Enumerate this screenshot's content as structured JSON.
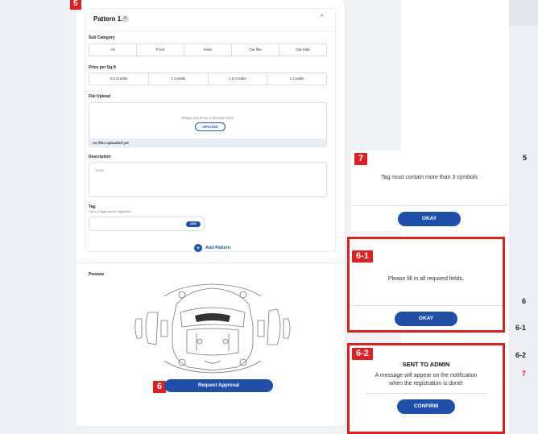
{
  "markers": {
    "m5": "5",
    "m6": "6",
    "m7": "7",
    "m61": "6-1",
    "m62": "6-2"
  },
  "pattern": {
    "title": "Pattern 1.",
    "close_symbol": "×",
    "chevron": "^"
  },
  "sub_category": {
    "label": "Sub Category",
    "options": [
      "All",
      "Front",
      "Inner",
      "Out flex",
      "Out Side"
    ]
  },
  "price": {
    "label": "Price per Sq.ft",
    "options": [
      "0.5 Credits",
      "1 Credits",
      "1.5 Credits",
      "2 Credits"
    ]
  },
  "file_upload": {
    "label": "File Upload",
    "hint": "Drage and Drop or Browse Files",
    "button": "UPLOAD",
    "status": "no files uploaded yet"
  },
  "description": {
    "label": "Description",
    "placeholder": "Enter.."
  },
  "tag": {
    "label": "Tag",
    "note": "*Up to 5 tags can be registered.",
    "add_button": "ADD"
  },
  "add_pattern": {
    "label": "Add Pattern",
    "icon": "plus-circle-icon"
  },
  "preview": {
    "label": "Preview",
    "image": "car-wrap-template"
  },
  "request_button": "Request Approval",
  "dialog7": {
    "message": "Tag must contain more than 3 symbols",
    "button": "OKAY"
  },
  "dialog61": {
    "message": "Please fill in all required fields.",
    "button": "OKAY"
  },
  "dialog62": {
    "title": "SENT TO ADMIN",
    "line1": "A message will appear on the notification",
    "line2": "when the registration is done!",
    "button": "CONFIRM"
  },
  "side_markers": [
    "5",
    "6",
    "6-1",
    "6-2",
    "7"
  ],
  "colors": {
    "primary": "#1f4fa8",
    "marker_red": "#e02020"
  }
}
